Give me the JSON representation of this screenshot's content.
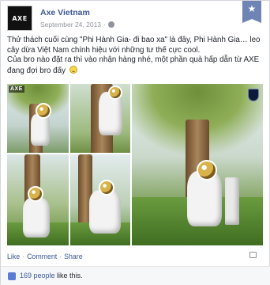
{
  "post": {
    "page_name": "Axe Vietnam",
    "avatar_text": "AXE",
    "date": "September 24, 2013",
    "date_sep": "·",
    "text_line1": "Thử thách cuối cùng \"Phi Hành Gia- đi bao xa\" là đây, Phi Hành Gia… leo cây dừa Việt Nam chính hiệu với những tư thế cực cool.",
    "text_line2": "Của bro nào đặt ra thì vào nhận hàng nhé, một phần quà hấp dẫn từ AXE đang đợi bro đấy"
  },
  "photos": {
    "label": "AXE",
    "items": [
      "astronaut-photo-1",
      "astronaut-photo-2",
      "astronaut-photo-3",
      "astronaut-photo-4",
      "astronaut-photo-5"
    ]
  },
  "actions": {
    "like": "Like",
    "comment": "Comment",
    "share": "Share",
    "sep": "·"
  },
  "likes": {
    "count_link": "169 people",
    "suffix": " like this."
  },
  "colors": {
    "link": "#3b5998",
    "muted": "#90949c",
    "star_tab": "#6d84b4"
  },
  "icons": [
    "star-icon",
    "globe-icon",
    "smile-icon",
    "like-thumb-icon",
    "comment-bubble-icon",
    "badge-icon"
  ]
}
